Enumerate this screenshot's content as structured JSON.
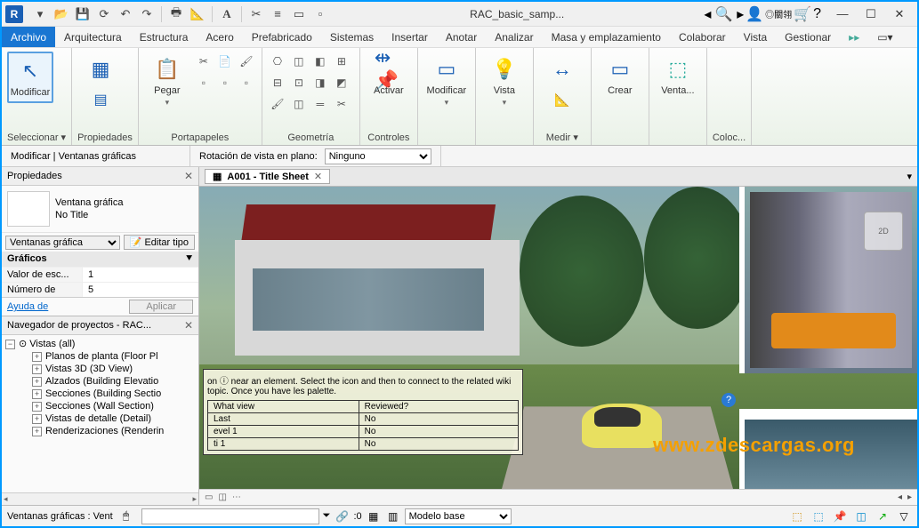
{
  "title": {
    "filename": "RAC_basic_samp..."
  },
  "menu": {
    "tabs": [
      "Archivo",
      "Arquitectura",
      "Estructura",
      "Acero",
      "Prefabricado",
      "Sistemas",
      "Insertar",
      "Anotar",
      "Analizar",
      "Masa y emplazamiento",
      "Colaborar",
      "Vista",
      "Gestionar"
    ],
    "active": "Archivo"
  },
  "ribbon": {
    "panels": [
      {
        "label": "Seleccionar ▾",
        "big": {
          "txt": "Modificar",
          "icon": "↖"
        }
      },
      {
        "label": "Propiedades",
        "big": {
          "txt": "",
          "icon": "▦"
        }
      },
      {
        "label": "Portapapeles",
        "big": {
          "txt": "Pegar",
          "icon": "📋"
        }
      },
      {
        "label": "Geometría"
      },
      {
        "label": "Controles",
        "big": {
          "txt": "Activar",
          "icon": "↔"
        }
      },
      {
        "label": "",
        "big": {
          "txt": "Modificar",
          "icon": "▭"
        }
      },
      {
        "label": "",
        "big": {
          "txt": "Vista",
          "icon": "💡"
        }
      },
      {
        "label": "Medir ▾",
        "big": {
          "txt": "",
          "icon": "↔"
        }
      },
      {
        "label": "",
        "big": {
          "txt": "Crear",
          "icon": "▭"
        }
      },
      {
        "label": "",
        "big": {
          "txt": "Venta...",
          "icon": "⬚"
        }
      },
      {
        "label": "Coloc..."
      }
    ]
  },
  "optbar": {
    "context": "Modificar | Ventanas gráficas",
    "rot_label": "Rotación de vista en plano:",
    "rot_value": "Ninguno"
  },
  "props": {
    "title": "Propiedades",
    "type_line1": "Ventana gráfica",
    "type_line2": "No Title",
    "selector": "Ventanas gráfica",
    "edit_type": "Editar tipo",
    "group": "Gráficos",
    "rows": [
      {
        "k": "Valor de esc...",
        "v": "1"
      },
      {
        "k": "Número de",
        "v": "5"
      }
    ],
    "help": "Ayuda de",
    "apply": "Aplicar"
  },
  "browser": {
    "title": "Navegador de proyectos - RAC...",
    "root": "Vistas (all)",
    "items": [
      "Planos de planta (Floor Pl",
      "Vistas 3D (3D View)",
      "Alzados (Building Elevatio",
      "Secciones (Building Sectio",
      "Secciones (Wall Section)",
      "Vistas de detalle (Detail)",
      "Renderizaciones (Renderin"
    ]
  },
  "viewtab": {
    "title": "A001 - Title Sheet"
  },
  "infobox": {
    "text": "on ⓘ near an element. Select the icon and then to connect to the related wiki topic. Once you have les palette.",
    "th1": "What view",
    "th2": "Reviewed?",
    "rows": [
      [
        "Last",
        "No"
      ],
      [
        "evel 1",
        "No"
      ],
      [
        "ti 1",
        "No"
      ]
    ]
  },
  "watermark": "www.zdescargas.org",
  "status": {
    "left": "Ventanas gráficas : Vent",
    "model": "Modelo base"
  },
  "navcube": "2D"
}
